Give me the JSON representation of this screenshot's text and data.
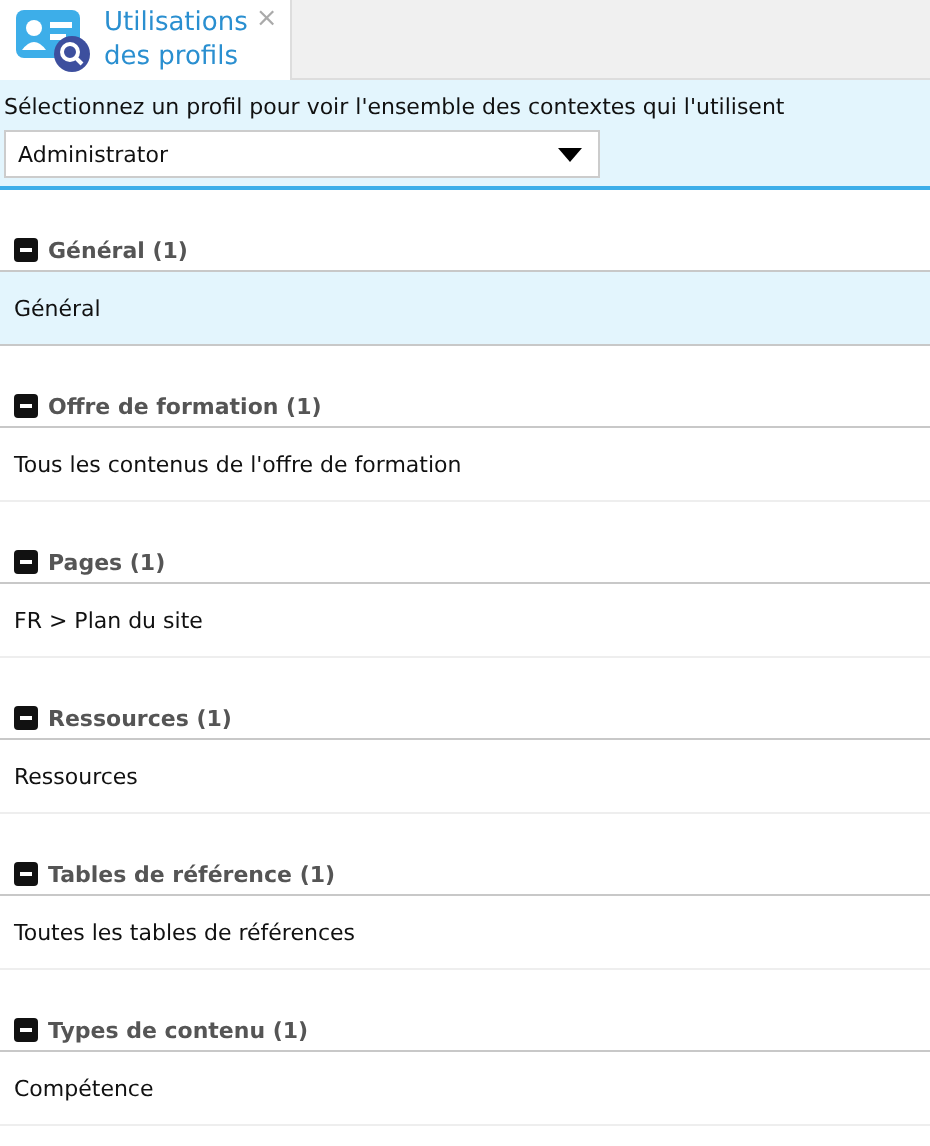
{
  "tab": {
    "title_lines": [
      "Utilisations",
      "des profils"
    ],
    "close": "×",
    "selected": true
  },
  "header": {
    "label": "Sélectionnez un profil pour voir l'ensemble des contextes qui l'utilisent",
    "select": {
      "value": "Administrator"
    }
  },
  "groups": [
    {
      "title": "Général (1)",
      "expanded": true,
      "items": [
        {
          "label": "Général",
          "selected": true
        }
      ]
    },
    {
      "title": "Offre de formation (1)",
      "expanded": true,
      "items": [
        {
          "label": "Tous les contenus de l'offre de formation",
          "selected": false
        }
      ]
    },
    {
      "title": "Pages (1)",
      "expanded": true,
      "items": [
        {
          "label": "FR > Plan du site",
          "selected": false
        }
      ]
    },
    {
      "title": "Ressources (1)",
      "expanded": true,
      "items": [
        {
          "label": "Ressources",
          "selected": false
        }
      ]
    },
    {
      "title": "Tables de référence (1)",
      "expanded": true,
      "items": [
        {
          "label": "Toutes les tables de références",
          "selected": false
        }
      ]
    },
    {
      "title": "Types de contenu (1)",
      "expanded": true,
      "items": [
        {
          "label": "Compétence",
          "selected": false
        }
      ]
    }
  ]
}
